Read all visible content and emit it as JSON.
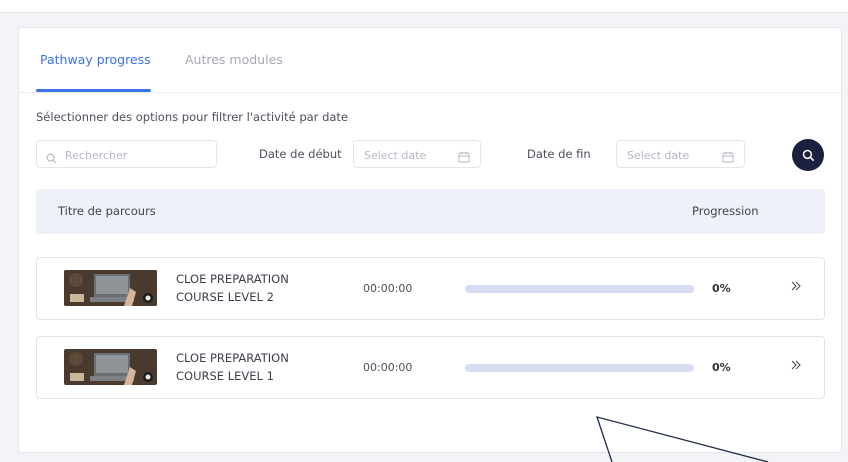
{
  "tabs": [
    {
      "label": "Pathway progress",
      "active": true
    },
    {
      "label": "Autres modules",
      "active": false
    }
  ],
  "filter": {
    "title": "Sélectionner des options pour filtrer l'activité par date",
    "search_placeholder": "Rechercher",
    "start_label": "Date de début",
    "start_placeholder": "Select date",
    "end_label": "Date de fin",
    "end_placeholder": "Select date"
  },
  "table": {
    "headers": {
      "title": "Titre de parcours",
      "progress": "Progression"
    },
    "rows": [
      {
        "title": "CLOE PREPARATION COURSE LEVEL 2",
        "time": "00:00:00",
        "progress_percent": 0,
        "progress_label": "0%"
      },
      {
        "title": "CLOE PREPARATION COURSE LEVEL 1",
        "time": "00:00:00",
        "progress_percent": 0,
        "progress_label": "0%"
      }
    ]
  },
  "colors": {
    "accent": "#3a73e8",
    "search_button": "#1c1f3d",
    "progress_track": "#d5dcef",
    "header_bg": "#eef1f8"
  },
  "icons": {
    "search": "search-icon",
    "calendar": "calendar-icon",
    "open": "double-chevron-right-icon"
  }
}
